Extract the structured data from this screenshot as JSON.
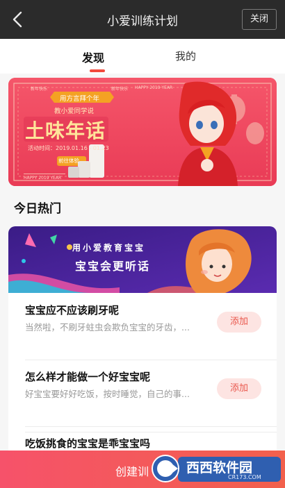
{
  "header": {
    "title": "小爱训练计划",
    "close_label": "关闭"
  },
  "tabs": [
    {
      "label": "发现",
      "active": true
    },
    {
      "label": "我的",
      "active": false
    }
  ],
  "banner": {
    "ribbon": "用方言拜个年",
    "subtitle": "教小爱同学说",
    "headline": "土味年话",
    "date": "活动时间：2019.01.16 - 01.23",
    "button": "前往体验",
    "tag": "HAPPY 2019 YEAR",
    "decor_text": "新年快乐"
  },
  "section": {
    "title": "今日热门"
  },
  "card_banner": {
    "line1": "用小爱教育宝宝",
    "line2": "宝宝会更听话"
  },
  "items": [
    {
      "title": "宝宝应不应该刷牙呢",
      "desc": "当然啦，不刷牙蛀虫会欺负宝宝的牙齿，...",
      "button": "添加"
    },
    {
      "title": "怎么样才能做一个好宝宝呢",
      "desc": "好宝宝要好好吃饭，按时睡觉，自己的事...",
      "button": "添加"
    },
    {
      "title": "吃饭挑食的宝宝是乖宝宝吗",
      "desc": "",
      "button": ""
    }
  ],
  "bottom": {
    "label": "创建训"
  },
  "watermark": {
    "text": "西西软件园",
    "url": "CR173.COM"
  },
  "colors": {
    "accent": "#f24a3c",
    "titlebar": "#2b2b2b",
    "banner_red": "#f0465c",
    "add_bg": "#fde4e2",
    "add_text": "#e9574c"
  }
}
